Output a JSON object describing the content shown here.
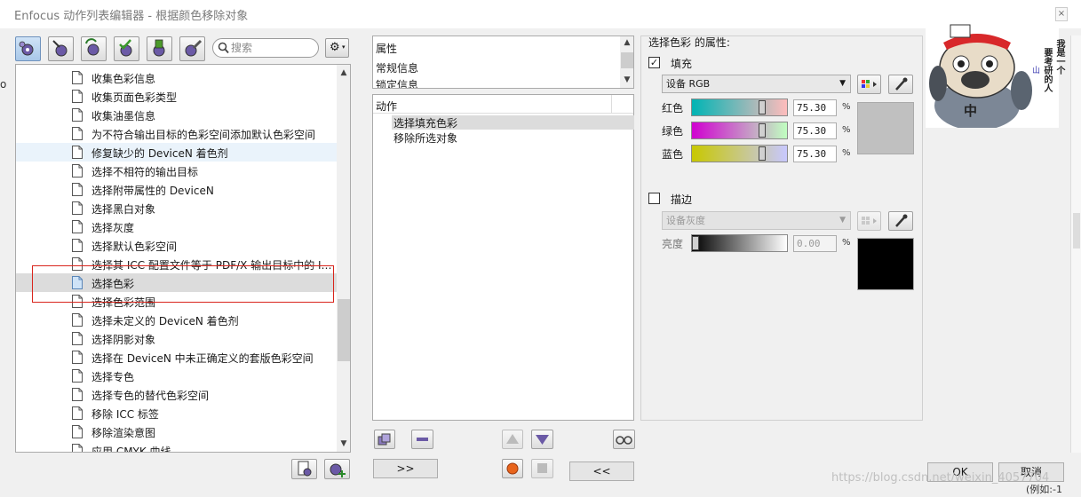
{
  "window": {
    "title": "Enfocus 动作列表编辑器 - 根据颜色移除对象"
  },
  "left_edge_fragment": "o",
  "search": {
    "placeholder": "搜索"
  },
  "action_list": {
    "items": [
      "收集色彩信息",
      "收集页面色彩类型",
      "收集油墨信息",
      "为不符合输出目标的色彩空间添加默认色彩空间",
      "修复缺少的 DeviceN 着色剂",
      "选择不相符的输出目标",
      "选择附带属性的 DeviceN",
      "选择黑白对象",
      "选择灰度",
      "选择默认色彩空间",
      "选择其 ICC 配置文件等于 PDF/X 输出目标中的 I…",
      "选择色彩",
      "选择色彩范围",
      "选择未定义的 DeviceN 着色剂",
      "选择阴影对象",
      "选择在 DeviceN 中未正确定义的套版色彩空间",
      "选择专色",
      "选择专色的替代色彩空间",
      "移除 ICC 标签",
      "移除渲染意图",
      "应用 CMYK 曲线"
    ],
    "hover_index": 4,
    "selected_index": 11
  },
  "properties_panel": {
    "items": [
      "属性",
      "常规信息",
      "锁定信息"
    ]
  },
  "actions_panel": {
    "header": "动作",
    "items": [
      "选择填充色彩",
      "移除所选对象"
    ]
  },
  "buttons": {
    "move_right": ">>",
    "move_left": "<<",
    "ok": "OK",
    "cancel": "取消"
  },
  "color_props": {
    "title": "选择色彩 的属性:",
    "fill": {
      "label": "填充",
      "checked": true,
      "check_mark": "✓",
      "color_space": "设备 RGB",
      "channels": [
        {
          "label": "红色",
          "value": "75.30",
          "level": 0.753
        },
        {
          "label": "绿色",
          "value": "75.30",
          "level": 0.753
        },
        {
          "label": "蓝色",
          "value": "75.30",
          "level": 0.753
        }
      ],
      "percent": "%",
      "preview_color": "#c0c0c0"
    },
    "stroke": {
      "label": "描边",
      "checked": false,
      "color_space": "设备灰度",
      "channel": {
        "label": "亮度",
        "value": "0.00",
        "level": 0.0
      },
      "percent": "%",
      "preview_color": "#000000"
    }
  },
  "sticker": {
    "vertical_text_1": "我是一个",
    "vertical_text_2": "要考研的人",
    "char": "中"
  },
  "watermark": "https://blog.csdn.net/weixin_4057704",
  "bottom_fragment": "(例如:-1"
}
